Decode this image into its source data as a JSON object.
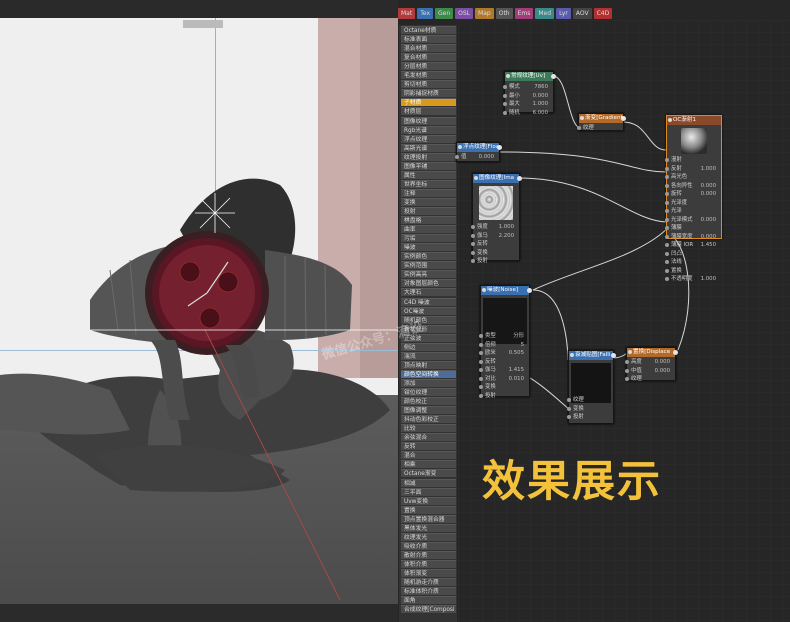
{
  "tabs": [
    {
      "label": "Mat",
      "color": "#b33a3a"
    },
    {
      "label": "Tex",
      "color": "#3a6fb0"
    },
    {
      "label": "Gen",
      "color": "#3d8a4a"
    },
    {
      "label": "OSL",
      "color": "#7a4fa3"
    },
    {
      "label": "Map",
      "color": "#b07a2a"
    },
    {
      "label": "Oth",
      "color": "#555555"
    },
    {
      "label": "Ems",
      "color": "#a33d7a"
    },
    {
      "label": "Med",
      "color": "#3a8a8a"
    },
    {
      "label": "Lyr",
      "color": "#5a5ab0"
    },
    {
      "label": "AOV",
      "color": "#444444"
    },
    {
      "label": "C4D",
      "color": "#b33030"
    }
  ],
  "menu_items": [
    "Octane材质",
    "标准表面",
    "混合材质",
    "复合材质",
    "分层材质",
    "毛发材质",
    "剪切材质",
    "阴影捕捉材质",
    "子材质",
    "材质层",
    "图像纹理",
    "Rgb光谱",
    "浮点纹理",
    "高斯光谱",
    "纹理投射",
    "图像平铺",
    "属性",
    "世界坐标",
    "注释",
    "变换",
    "投射",
    "棋盘格",
    "曲率",
    "污垢",
    "噪波",
    "实例颜色",
    "实例范围",
    "实例高亮",
    "对象图层颜色",
    "大理石",
    "C4D 噪波",
    "OC噪波",
    "随机颜色",
    "脊状分形",
    "正弦波",
    "侧边",
    "湍流",
    "顶点映射",
    "颜色空间转换",
    "添加",
    "钳位纹理",
    "颜色校正",
    "图像调整",
    "抖动色彩校正",
    "比较",
    "余弦混合",
    "反转",
    "混合",
    "相乘",
    "Octane渐变",
    "相减",
    "三平面",
    "Uvw变换",
    "置换",
    "顶点置换混合器",
    "黑体发光",
    "纹理发光",
    "吸收介质",
    "散射介质",
    "体积介质",
    "体积渐变",
    "随机游走介质",
    "标准体积介质",
    "面角",
    "合成纹理[Composi"
  ],
  "nodes": {
    "uv_transform": {
      "title": "常规纹理[Uv]",
      "rows": [
        [
          "模式",
          "7860"
        ],
        [
          "最小",
          "0.000"
        ],
        [
          "最大",
          "1.000"
        ],
        [
          "随机",
          "6.000"
        ]
      ]
    },
    "gradient": {
      "title": "渐变[Gradient]",
      "rows": [
        [
          "纹理",
          ""
        ]
      ]
    },
    "octane": {
      "title": "OC渐射1",
      "rows": [
        [
          "漫射",
          ""
        ],
        [
          "反射",
          "1.000"
        ],
        [
          "高光色",
          ""
        ],
        [
          "各向异性",
          "0.000"
        ],
        [
          "旋转",
          "0.000"
        ],
        [
          "光泽度",
          ""
        ],
        [
          "光泽",
          ""
        ],
        [
          "光泽模式",
          "0.000"
        ],
        [
          "薄膜",
          ""
        ],
        [
          "薄膜宽度",
          "0.000"
        ],
        [
          "薄膜 IOR",
          "1.450"
        ],
        [
          "凹凸",
          ""
        ],
        [
          "法线",
          ""
        ],
        [
          "置换",
          ""
        ],
        [
          "不透明度",
          "1.000"
        ]
      ]
    },
    "float": {
      "title": "浮点纹理[Float",
      "rows": [
        [
          "值",
          "0.000"
        ]
      ]
    },
    "image": {
      "title": "图像纹理[Ima",
      "rows": [
        [
          "强度",
          "1.000"
        ],
        [
          "伽马",
          "2.200"
        ],
        [
          "反转",
          ""
        ],
        [
          "变换",
          ""
        ],
        [
          "投射",
          ""
        ]
      ]
    },
    "noise": {
      "title": "噪波[Noise]",
      "rows": [
        [
          "类型",
          "分形"
        ],
        [
          "倍频",
          "5"
        ],
        [
          "欧米",
          "0.505"
        ],
        [
          "反转",
          ""
        ],
        [
          "伽马",
          "1.415"
        ],
        [
          "对比",
          "0.010"
        ],
        [
          "变换",
          ""
        ],
        [
          "投射",
          ""
        ]
      ]
    },
    "falloff": {
      "title": "衰减贴图[Falli",
      "rows": [
        [
          "纹理",
          ""
        ],
        [
          "变换",
          ""
        ],
        [
          "投射",
          ""
        ]
      ]
    },
    "displacement": {
      "title": "置换[Displace",
      "rows": [
        [
          "高度",
          "0.000"
        ],
        [
          "中值",
          "0.000"
        ],
        [
          "纹理",
          ""
        ]
      ]
    }
  },
  "caption": "效果展示",
  "watermark": "微信公众号：滴设",
  "colors": {
    "accent": "#f3c23a",
    "selected_node": "#e08a1a",
    "highlight_menu": "#d79a1e"
  }
}
